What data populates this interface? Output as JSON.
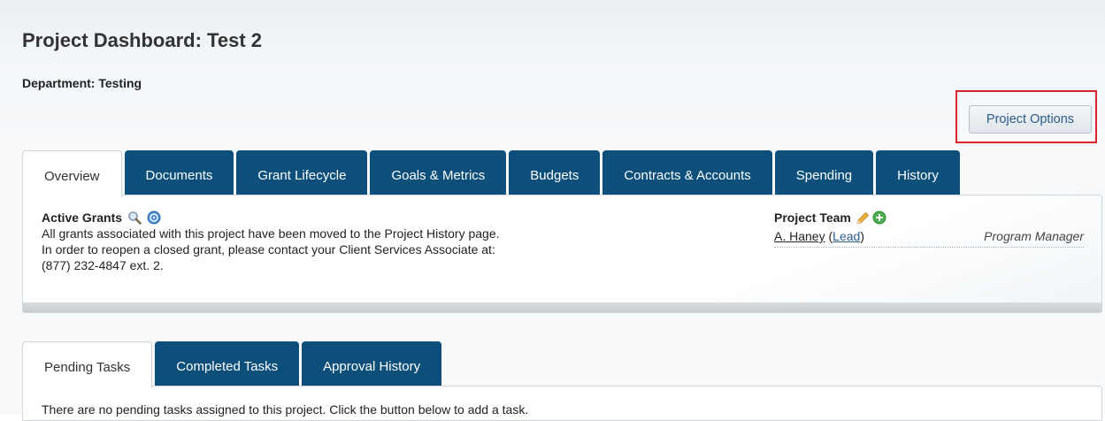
{
  "header": {
    "title": "Project Dashboard: Test 2",
    "department": "Department: Testing",
    "options_button": "Project Options"
  },
  "tabs": [
    {
      "label": "Overview",
      "active": true
    },
    {
      "label": "Documents"
    },
    {
      "label": "Grant Lifecycle"
    },
    {
      "label": "Goals & Metrics"
    },
    {
      "label": "Budgets"
    },
    {
      "label": "Contracts & Accounts"
    },
    {
      "label": "Spending"
    },
    {
      "label": "History"
    }
  ],
  "overview": {
    "grants_heading": "Active Grants",
    "grants_lines": [
      "All grants associated with this project have been moved to the Project History page.",
      "In order to reopen a closed grant, please contact your Client Services Associate at:",
      "(877) 232-4847 ext. 2."
    ],
    "team_heading": "Project Team",
    "team_member": {
      "name": "A. Haney",
      "lead_open": "(",
      "lead_label": "Lead",
      "lead_close": ")",
      "role": "Program Manager"
    }
  },
  "task_tabs": [
    {
      "label": "Pending Tasks",
      "active": true
    },
    {
      "label": "Completed Tasks"
    },
    {
      "label": "Approval History"
    }
  ],
  "tasks": {
    "empty_message": "There are no pending tasks assigned to this project. Click the button below to add a task."
  },
  "colors": {
    "tab_blue": "#0c4f7b",
    "highlight_red": "#d9232d",
    "link_blue": "#2b5d8c"
  }
}
